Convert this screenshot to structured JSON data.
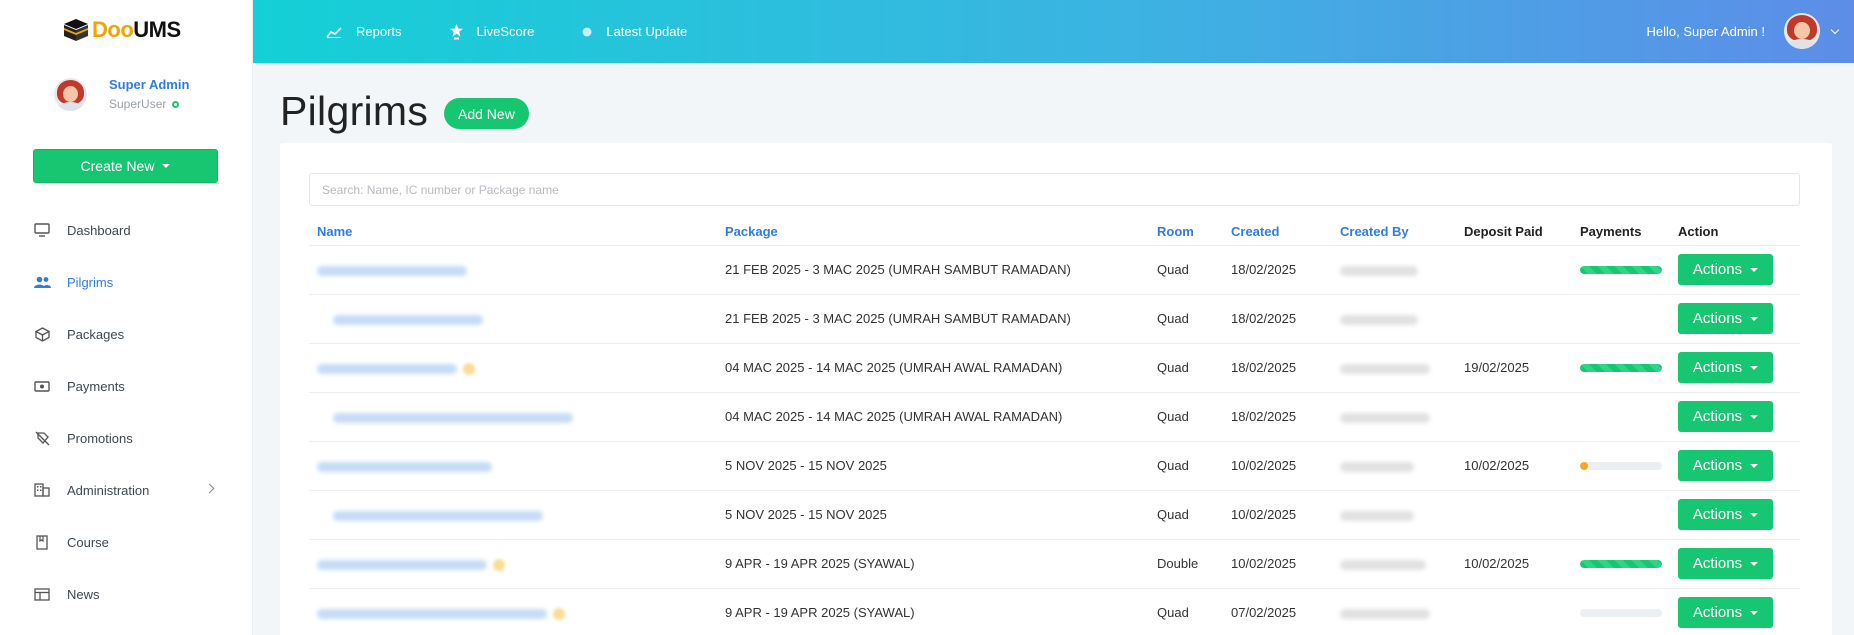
{
  "brand": {
    "part1": "Doo",
    "part2": "UMS"
  },
  "sidebar": {
    "user_name": "Super Admin",
    "user_role": "SuperUser",
    "create_label": "Create New",
    "items": [
      {
        "label": "Dashboard",
        "icon": "monitor-icon"
      },
      {
        "label": "Pilgrims",
        "icon": "users-icon"
      },
      {
        "label": "Packages",
        "icon": "box-icon"
      },
      {
        "label": "Payments",
        "icon": "money-icon"
      },
      {
        "label": "Promotions",
        "icon": "tag-off-icon"
      },
      {
        "label": "Administration",
        "icon": "building-icon"
      },
      {
        "label": "Course",
        "icon": "book-icon"
      },
      {
        "label": "News",
        "icon": "news-icon"
      }
    ]
  },
  "topbar": {
    "nav": [
      "Reports",
      "LiveScore",
      "Latest Update"
    ],
    "greeting": "Hello, Super Admin !"
  },
  "page": {
    "title": "Pilgrims",
    "add_label": "Add New"
  },
  "search": {
    "placeholder": "Search: Name, IC number or Package name"
  },
  "table": {
    "headers": [
      "Name",
      "Package",
      "Room",
      "Created",
      "Created By",
      "Deposit Paid",
      "Payments",
      "Action"
    ],
    "action_label": "Actions",
    "rows": [
      {
        "package": "21 FEB 2025 - 3 MAC 2025 (UMRAH SAMBUT RAMADAN)",
        "room": "Quad",
        "created": "18/02/2025",
        "deposit": "",
        "payment": 100
      },
      {
        "package": "21 FEB 2025 - 3 MAC 2025 (UMRAH SAMBUT RAMADAN)",
        "room": "Quad",
        "created": "18/02/2025",
        "deposit": "",
        "payment": null
      },
      {
        "package": "04 MAC 2025 - 14 MAC 2025 (UMRAH AWAL RAMADAN)",
        "room": "Quad",
        "created": "18/02/2025",
        "deposit": "19/02/2025",
        "payment": 100
      },
      {
        "package": "04 MAC 2025 - 14 MAC 2025 (UMRAH AWAL RAMADAN)",
        "room": "Quad",
        "created": "18/02/2025",
        "deposit": "",
        "payment": null
      },
      {
        "package": "5 NOV 2025 - 15 NOV 2025",
        "room": "Quad",
        "created": "10/02/2025",
        "deposit": "10/02/2025",
        "payment": 10
      },
      {
        "package": "5 NOV 2025 - 15 NOV 2025",
        "room": "Quad",
        "created": "10/02/2025",
        "deposit": "",
        "payment": null
      },
      {
        "package": "9 APR - 19 APR 2025 (SYAWAL)",
        "room": "Double",
        "created": "10/02/2025",
        "deposit": "10/02/2025",
        "payment": 100
      },
      {
        "package": "9 APR - 19 APR 2025 (SYAWAL)",
        "room": "Quad",
        "created": "07/02/2025",
        "deposit": "",
        "payment": 0
      }
    ]
  }
}
